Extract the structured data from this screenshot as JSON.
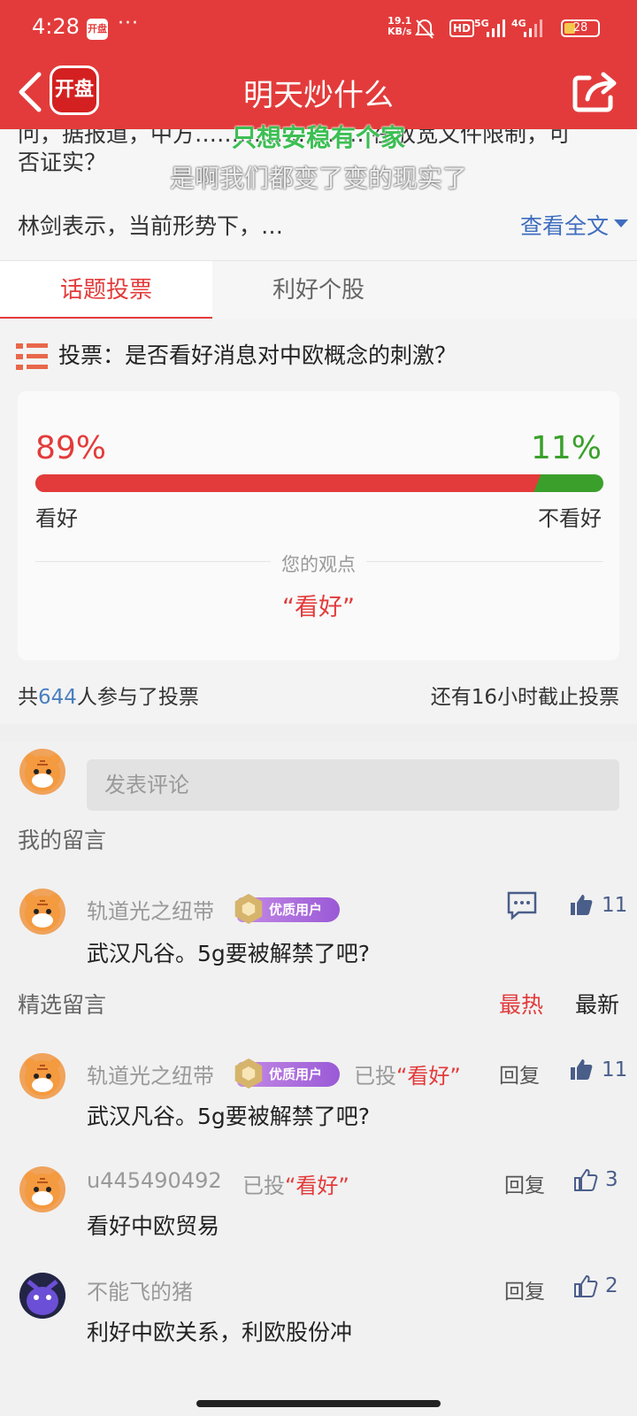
{
  "status_bar": {
    "time": "4:28",
    "app_mini": "开盘",
    "dots": "···",
    "net_speed": "19.1",
    "net_unit": "KB/s",
    "hd": "HD",
    "sig1": "5G",
    "sig2": "4G",
    "battery": "28"
  },
  "header": {
    "logo": "开盘",
    "title": "明天炒什么"
  },
  "article": {
    "line1": "问，据报道，中方……………………在放宽文件限制，可",
    "line2": "否证实？",
    "line3": "林剑表示，当前形势下，…",
    "read_more": "查看全文"
  },
  "lyrics": {
    "line1": "只想安稳有个家",
    "line2": "是啊我们都变了变的现实了"
  },
  "tabs": [
    {
      "label": "话题投票"
    },
    {
      "label": "利好个股"
    }
  ],
  "vote": {
    "question": "投票：是否看好消息对中欧概念的刺激？",
    "positive_pct": "89%",
    "negative_pct": "11%",
    "positive_fraction": 0.89,
    "positive_label": "看好",
    "negative_label": "不看好",
    "your_view_title": "您的观点",
    "your_view_value": "“看好”",
    "participants_prefix": "共",
    "participants_count": "644",
    "participants_suffix": "人参与了投票",
    "deadline": "还有16小时截止投票"
  },
  "comments": {
    "input_placeholder": "发表评论",
    "my_section": "我的留言",
    "featured_section": "精选留言",
    "sort_hot": "最热",
    "sort_new": "最新",
    "badge_text": "优质用户",
    "voted_prefix": "已投",
    "reply_label": "回复",
    "my_comment": {
      "user": "轨道光之纽带",
      "text": "武汉凡谷。5g要被解禁了吧?",
      "likes": "11"
    },
    "featured": [
      {
        "user": "轨道光之纽带",
        "voted": "“看好”",
        "text": "武汉凡谷。5g要被解禁了吧?",
        "likes": "11"
      },
      {
        "user": "u445490492",
        "voted": "“看好”",
        "text": "看好中欧贸易",
        "likes": "3"
      },
      {
        "user": "不能飞的猪",
        "text": "利好中欧关系，利欧股份冲",
        "likes": "2"
      }
    ]
  }
}
